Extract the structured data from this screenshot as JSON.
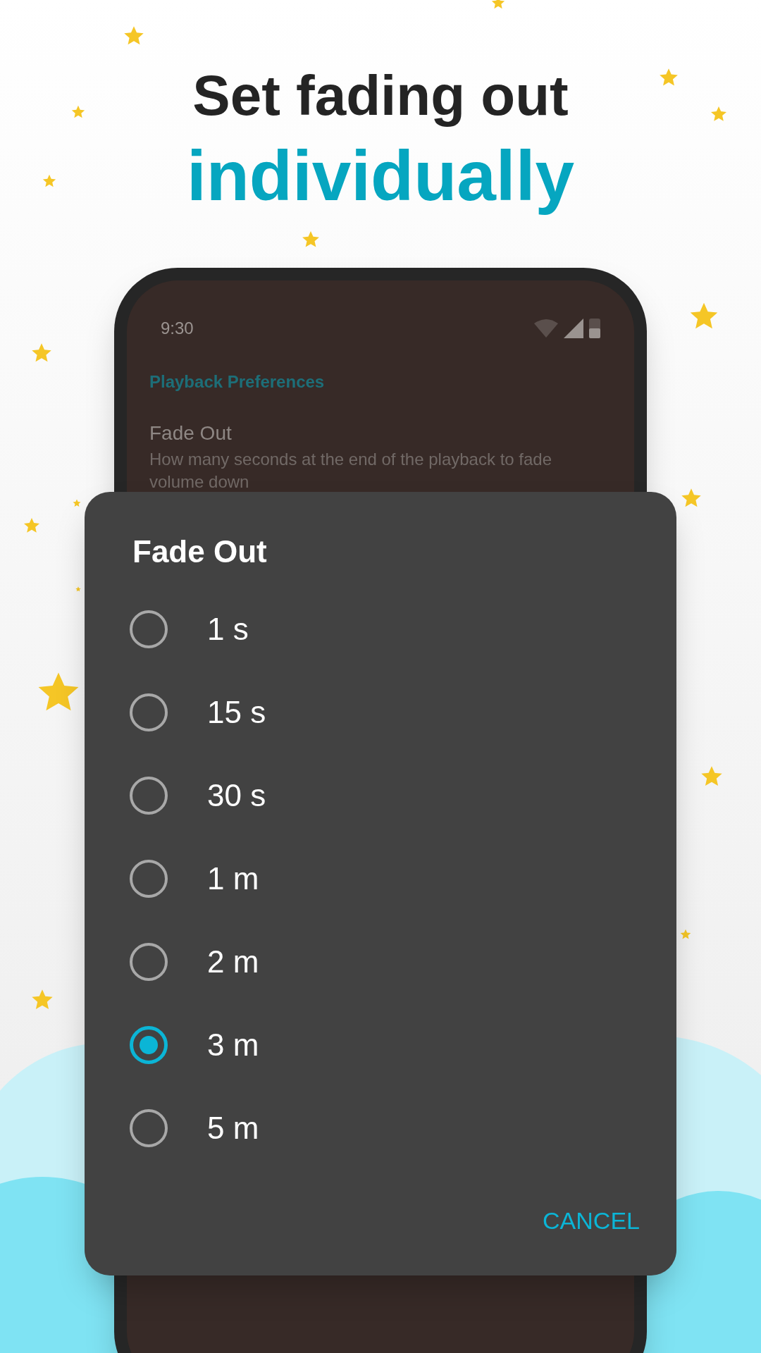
{
  "headline": {
    "line_1": "Set fading out",
    "line_2": "individually"
  },
  "status_bar": {
    "time": "9:30"
  },
  "settings": {
    "section_header": "Playback Preferences",
    "preference": {
      "title": "Fade Out",
      "summary": "How many seconds at the end of the playback to fade volume down"
    }
  },
  "dialog": {
    "title": "Fade Out",
    "options": [
      {
        "label": "1 s",
        "selected": false
      },
      {
        "label": "15 s",
        "selected": false
      },
      {
        "label": "30 s",
        "selected": false
      },
      {
        "label": "1 m",
        "selected": false
      },
      {
        "label": "2 m",
        "selected": false
      },
      {
        "label": "3 m",
        "selected": true
      },
      {
        "label": "5 m",
        "selected": false
      }
    ],
    "cancel_button": "CANCEL"
  }
}
